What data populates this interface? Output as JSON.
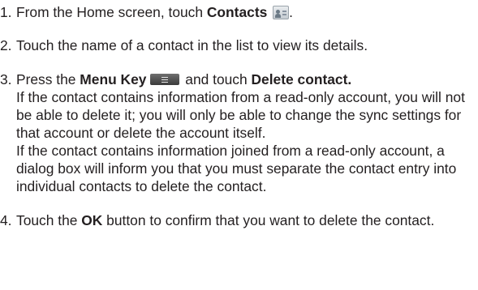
{
  "steps": [
    {
      "number": "1.",
      "segments": {
        "t1": "From the Home screen, touch ",
        "b1": "Contacts",
        "t2": " "
      },
      "icon": "contacts-icon"
    },
    {
      "number": "2.",
      "segments": {
        "t1": "Touch the name of a contact in the list to view its details."
      }
    },
    {
      "number": "3.",
      "segments": {
        "t1": "Press the ",
        "b1": "Menu Key",
        "t2": " and touch ",
        "b2": "Delete contact.",
        "p1": "If the contact contains information from a read-only account, you will not be able to delete it; you will only be able to change the sync settings for that account or delete the account itself.",
        "p2": "If the contact contains information joined from a read-only account, a dialog box will inform you that you must separate the contact entry into individual contacts to delete the contact."
      },
      "icon": "menu-key-icon"
    },
    {
      "number": "4.",
      "segments": {
        "t1": "Touch the ",
        "b1": "OK",
        "t2": " button to confirm that you want to delete the contact."
      }
    }
  ]
}
